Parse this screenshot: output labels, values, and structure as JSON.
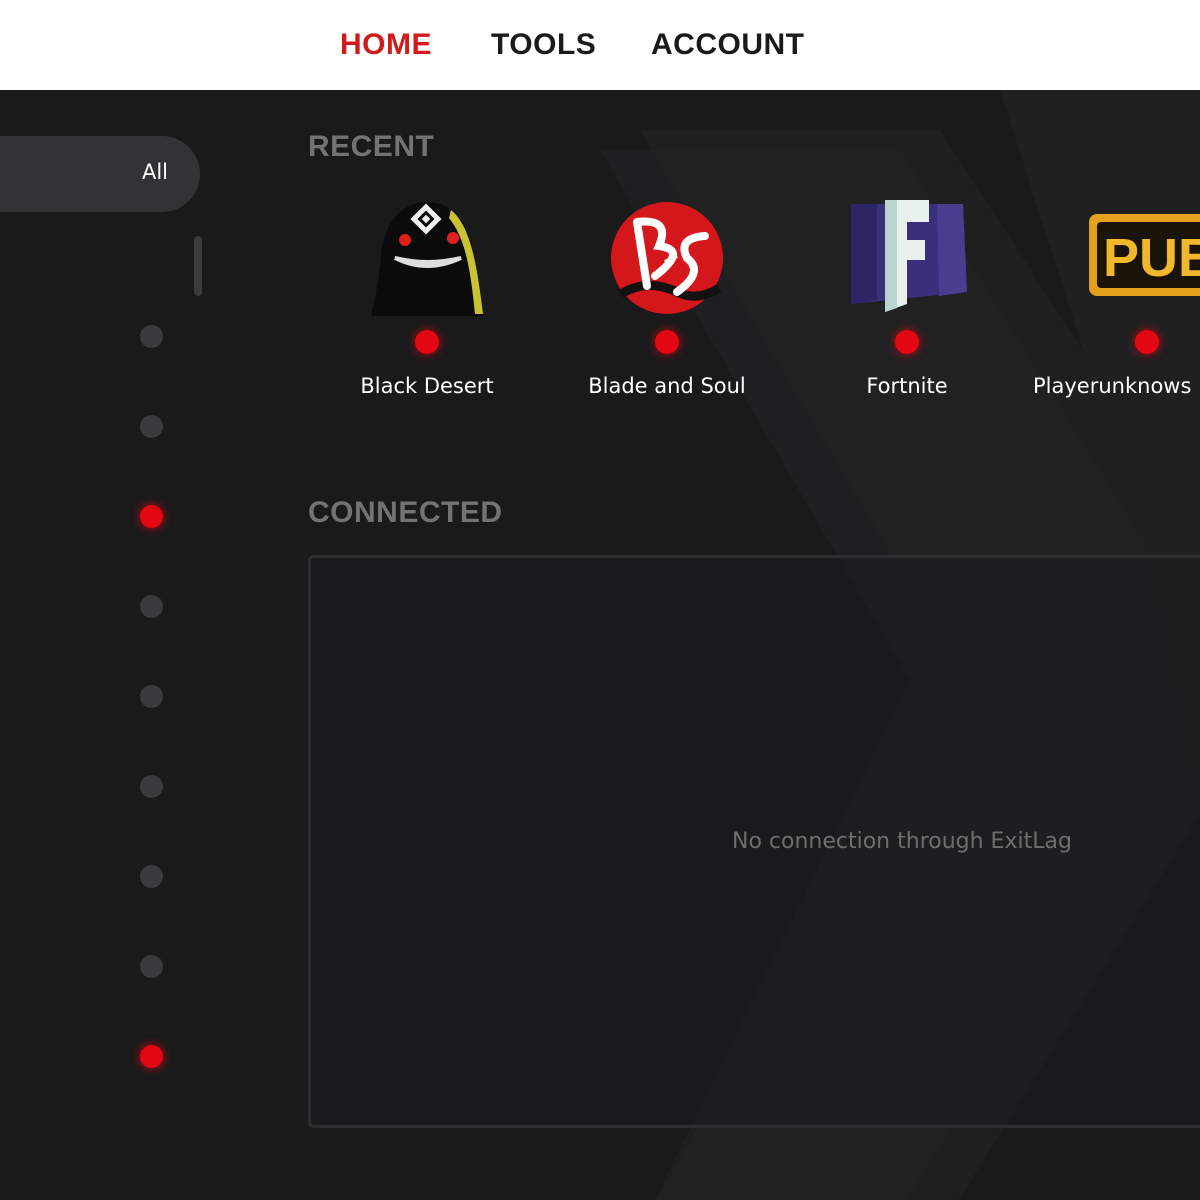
{
  "nav": {
    "items": [
      {
        "label": "HOME",
        "active": true
      },
      {
        "label": "TOOLS",
        "active": false
      },
      {
        "label": "ACCOUNT",
        "active": false
      }
    ]
  },
  "sidebar": {
    "filter_label": "All",
    "status_dots": [
      "off",
      "off",
      "on",
      "off",
      "off",
      "off",
      "off",
      "off",
      "on"
    ]
  },
  "recent": {
    "title": "RECENT",
    "games": [
      {
        "name": "Black Desert",
        "icon": "black-desert-icon",
        "status": "red"
      },
      {
        "name": "Blade and Soul",
        "icon": "blade-and-soul-icon",
        "status": "red"
      },
      {
        "name": "Fortnite",
        "icon": "fortnite-icon",
        "status": "red"
      },
      {
        "name": "Playerunknows Battlegrounds",
        "icon": "pubg-icon",
        "status": "red"
      }
    ]
  },
  "connected": {
    "title": "CONNECTED",
    "empty_message": "No connection through ExitLag"
  },
  "colors": {
    "accent": "#e30613",
    "nav_active": "#d11a1a",
    "background": "#1a1a1b",
    "section_title": "#737373"
  }
}
